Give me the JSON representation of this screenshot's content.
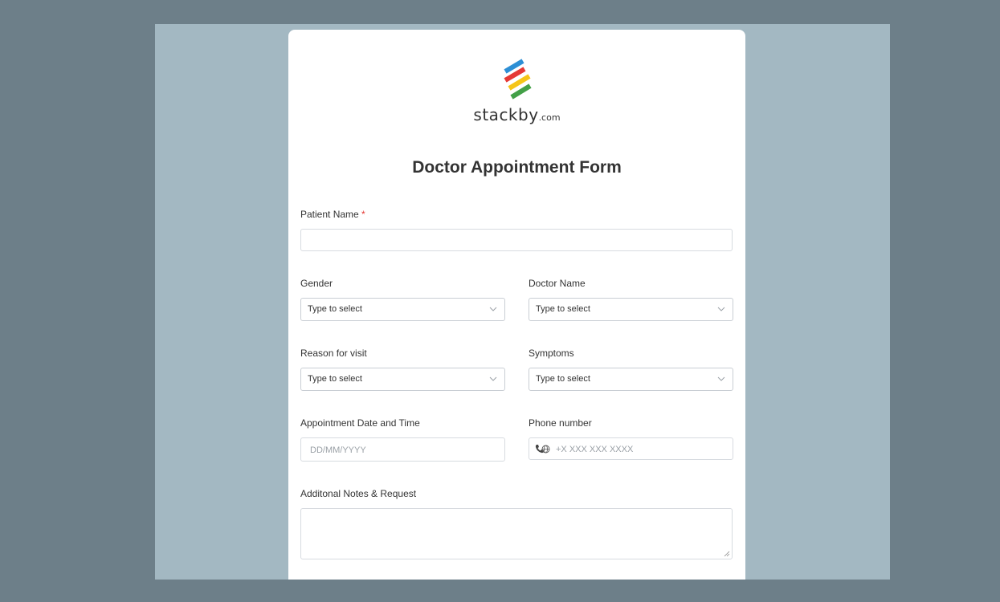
{
  "logo": {
    "brand": "stackby",
    "domain_suffix": ".com",
    "stripe_colors": [
      "#2d8fd5",
      "#e53935",
      "#f5c518",
      "#43a047"
    ]
  },
  "form": {
    "title": "Doctor Appointment Form",
    "patient_name": {
      "label": "Patient Name",
      "required_mark": "*",
      "value": ""
    },
    "gender": {
      "label": "Gender",
      "placeholder": "Type to select"
    },
    "doctor_name": {
      "label": "Doctor Name",
      "placeholder": "Type to select"
    },
    "reason": {
      "label": "Reason for visit",
      "placeholder": "Type to select"
    },
    "symptoms": {
      "label": "Symptoms",
      "placeholder": "Type to select"
    },
    "appointment": {
      "label": "Appointment Date and Time",
      "placeholder": "DD/MM/YYYY"
    },
    "phone": {
      "label": "Phone number",
      "placeholder": "+X XXX XXX XXXX"
    },
    "notes": {
      "label": "Additonal Notes & Request",
      "value": ""
    }
  },
  "icons": {
    "select_chevron": "chevron-down-icon",
    "phone": "phone-icon",
    "globe": "globe-icon",
    "resize": "resize-grip-icon"
  }
}
